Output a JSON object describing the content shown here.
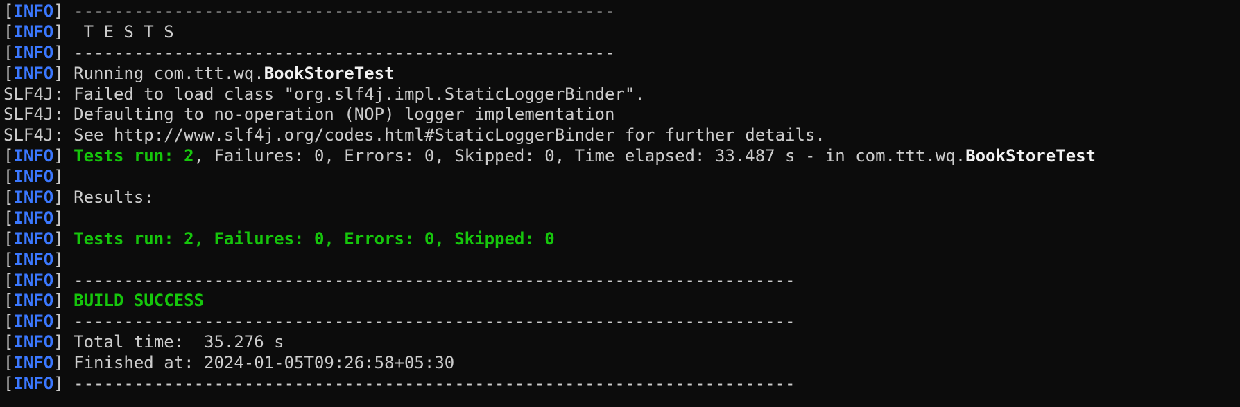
{
  "colors": {
    "background": "#0c0c0c",
    "text": "#cccccc",
    "level": "#3b78ff",
    "success": "#16c60c",
    "bold": "#f2f2f2"
  },
  "level_tag": "INFO",
  "lines": [
    {
      "level": "INFO",
      "segments": [
        {
          "text": " ------------------------------------------------------",
          "style": "plain"
        }
      ]
    },
    {
      "level": "INFO",
      "segments": [
        {
          "text": "  T E S T S",
          "style": "plain"
        }
      ]
    },
    {
      "level": "INFO",
      "segments": [
        {
          "text": " ------------------------------------------------------",
          "style": "plain"
        }
      ]
    },
    {
      "level": "INFO",
      "segments": [
        {
          "text": " Running com.ttt.wq.",
          "style": "plain"
        },
        {
          "text": "BookStoreTest",
          "style": "bold"
        }
      ]
    },
    {
      "level": null,
      "segments": [
        {
          "text": "SLF4J: Failed to load class \"org.slf4j.impl.StaticLoggerBinder\".",
          "style": "plain"
        }
      ]
    },
    {
      "level": null,
      "segments": [
        {
          "text": "SLF4J: Defaulting to no-operation (NOP) logger implementation",
          "style": "plain"
        }
      ]
    },
    {
      "level": null,
      "segments": [
        {
          "text": "SLF4J: See http://www.slf4j.org/codes.html#StaticLoggerBinder for further details.",
          "style": "plain"
        }
      ]
    },
    {
      "level": "INFO",
      "segments": [
        {
          "text": " ",
          "style": "plain"
        },
        {
          "text": "Tests run: 2",
          "style": "green"
        },
        {
          "text": ", Failures: 0, Errors: 0, Skipped: 0, Time elapsed: 33.487 s - in com.ttt.wq.",
          "style": "plain"
        },
        {
          "text": "BookStoreTest",
          "style": "bold"
        }
      ]
    },
    {
      "level": "INFO",
      "segments": []
    },
    {
      "level": "INFO",
      "segments": [
        {
          "text": " Results:",
          "style": "plain"
        }
      ]
    },
    {
      "level": "INFO",
      "segments": []
    },
    {
      "level": "INFO",
      "segments": [
        {
          "text": " ",
          "style": "plain"
        },
        {
          "text": "Tests run: 2, Failures: 0, Errors: 0, Skipped: 0",
          "style": "green"
        }
      ]
    },
    {
      "level": "INFO",
      "segments": []
    },
    {
      "level": "INFO",
      "segments": [
        {
          "text": " ------------------------------------------------------------------------",
          "style": "plain"
        }
      ]
    },
    {
      "level": "INFO",
      "segments": [
        {
          "text": " ",
          "style": "plain"
        },
        {
          "text": "BUILD SUCCESS",
          "style": "green"
        }
      ]
    },
    {
      "level": "INFO",
      "segments": [
        {
          "text": " ------------------------------------------------------------------------",
          "style": "plain"
        }
      ]
    },
    {
      "level": "INFO",
      "segments": [
        {
          "text": " Total time:  35.276 s",
          "style": "plain"
        }
      ]
    },
    {
      "level": "INFO",
      "segments": [
        {
          "text": " Finished at: 2024-01-05T09:26:58+05:30",
          "style": "plain"
        }
      ]
    },
    {
      "level": "INFO",
      "segments": [
        {
          "text": " ------------------------------------------------------------------------",
          "style": "plain"
        }
      ]
    }
  ]
}
